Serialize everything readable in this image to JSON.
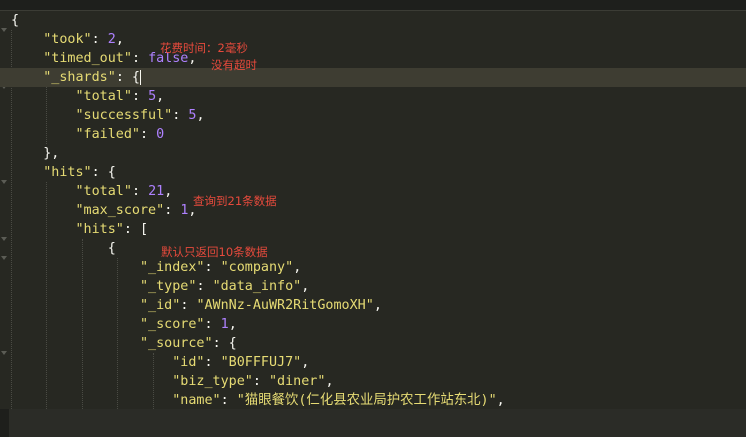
{
  "colors": {
    "background": "#272822",
    "string": "#e6db74",
    "number": "#ae81ff",
    "punctuation": "#f8f8f2",
    "annotation": "#e64a3c"
  },
  "lines": [
    {
      "indent": "",
      "parts": [
        [
          "p",
          "{"
        ]
      ]
    },
    {
      "indent": "    ",
      "parts": [
        [
          "k",
          "\"took\""
        ],
        [
          "p",
          ": "
        ],
        [
          "n",
          "2"
        ],
        [
          "p",
          ","
        ]
      ]
    },
    {
      "indent": "    ",
      "parts": [
        [
          "k",
          "\"timed_out\""
        ],
        [
          "p",
          ": "
        ],
        [
          "n",
          "false"
        ],
        [
          "p",
          ","
        ]
      ]
    },
    {
      "indent": "    ",
      "parts": [
        [
          "k",
          "\"_shards\""
        ],
        [
          "p",
          ": {"
        ]
      ],
      "cursor": true,
      "current": true
    },
    {
      "indent": "        ",
      "parts": [
        [
          "k",
          "\"total\""
        ],
        [
          "p",
          ": "
        ],
        [
          "n",
          "5"
        ],
        [
          "p",
          ","
        ]
      ]
    },
    {
      "indent": "        ",
      "parts": [
        [
          "k",
          "\"successful\""
        ],
        [
          "p",
          ": "
        ],
        [
          "n",
          "5"
        ],
        [
          "p",
          ","
        ]
      ]
    },
    {
      "indent": "        ",
      "parts": [
        [
          "k",
          "\"failed\""
        ],
        [
          "p",
          ": "
        ],
        [
          "n",
          "0"
        ]
      ]
    },
    {
      "indent": "    ",
      "parts": [
        [
          "p",
          "},"
        ]
      ]
    },
    {
      "indent": "    ",
      "parts": [
        [
          "k",
          "\"hits\""
        ],
        [
          "p",
          ": {"
        ]
      ]
    },
    {
      "indent": "        ",
      "parts": [
        [
          "k",
          "\"total\""
        ],
        [
          "p",
          ": "
        ],
        [
          "n",
          "21"
        ],
        [
          "p",
          ","
        ]
      ]
    },
    {
      "indent": "        ",
      "parts": [
        [
          "k",
          "\"max_score\""
        ],
        [
          "p",
          ": "
        ],
        [
          "n",
          "1"
        ],
        [
          "p",
          ","
        ]
      ]
    },
    {
      "indent": "        ",
      "parts": [
        [
          "k",
          "\"hits\""
        ],
        [
          "p",
          ": ["
        ]
      ]
    },
    {
      "indent": "            ",
      "parts": [
        [
          "p",
          "{"
        ]
      ]
    },
    {
      "indent": "                ",
      "parts": [
        [
          "k",
          "\"_index\""
        ],
        [
          "p",
          ": "
        ],
        [
          "k",
          "\"company\""
        ],
        [
          "p",
          ","
        ]
      ]
    },
    {
      "indent": "                ",
      "parts": [
        [
          "k",
          "\"_type\""
        ],
        [
          "p",
          ": "
        ],
        [
          "k",
          "\"data_info\""
        ],
        [
          "p",
          ","
        ]
      ]
    },
    {
      "indent": "                ",
      "parts": [
        [
          "k",
          "\"_id\""
        ],
        [
          "p",
          ": "
        ],
        [
          "k",
          "\"AWnNz-AuWR2RitGomoXH\""
        ],
        [
          "p",
          ","
        ]
      ]
    },
    {
      "indent": "                ",
      "parts": [
        [
          "k",
          "\"_score\""
        ],
        [
          "p",
          ": "
        ],
        [
          "n",
          "1"
        ],
        [
          "p",
          ","
        ]
      ]
    },
    {
      "indent": "                ",
      "parts": [
        [
          "k",
          "\"_source\""
        ],
        [
          "p",
          ": {"
        ]
      ]
    },
    {
      "indent": "                    ",
      "parts": [
        [
          "k",
          "\"id\""
        ],
        [
          "p",
          ": "
        ],
        [
          "k",
          "\"B0FFFUJ7\""
        ],
        [
          "p",
          ","
        ]
      ]
    },
    {
      "indent": "                    ",
      "parts": [
        [
          "k",
          "\"biz_type\""
        ],
        [
          "p",
          ": "
        ],
        [
          "k",
          "\"diner\""
        ],
        [
          "p",
          ","
        ]
      ]
    },
    {
      "indent": "                    ",
      "parts": [
        [
          "k",
          "\"name\""
        ],
        [
          "p",
          ": "
        ],
        [
          "k",
          "\"猫眼餐饮(仁化县农业局护农工作站东北)\""
        ],
        [
          "p",
          ","
        ]
      ]
    }
  ],
  "annotations": {
    "took_note": "花费时间：2毫秒",
    "timed_out_note": "没有超时",
    "total_note": "查询到21条数据",
    "hits_note": "默认只返回10条数据"
  }
}
